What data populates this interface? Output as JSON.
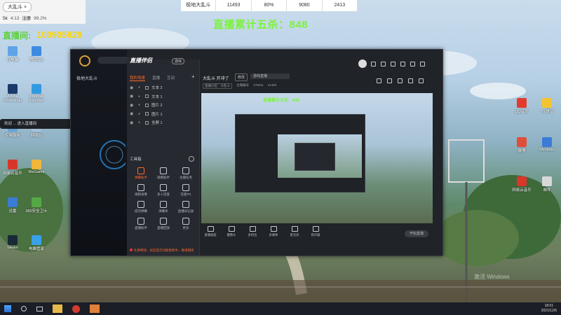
{
  "top_left": {
    "chip": "大乱斗 ×",
    "likes_label": "5k",
    "likes_value": "4:13",
    "rate_label": "注册",
    "rate_value": "99.2%"
  },
  "stats_row": [
    "极地大乱斗",
    "11493",
    "80%",
    "9080",
    "2413"
  ],
  "overlay": {
    "green_text": "直播累计五杀：848",
    "id_prefix": "直播间:",
    "id_number": "100905829"
  },
  "desktop_icons_left": [
    "此电脑",
    "腾讯QQ",
    "Adobe Photoshop",
    "Internet Explorer",
    "控制面板",
    "回收站",
    "网易云音乐",
    "WeGame",
    "迅雷",
    "360安全卫士",
    "Steam",
    "电脑管家"
  ],
  "desktop_icons_right": [
    "QQ音乐",
    "YY语音",
    "微博",
    "Windows",
    "网易云音乐",
    "邮件"
  ],
  "left_popup": "欢迎 ... 进入直播间",
  "app": {
    "title": "直播伴侣",
    "badge": "游戏",
    "game_tab": "极地大乱斗",
    "tabs": [
      "我的场景",
      "直播",
      "互动"
    ],
    "active_tab": 0,
    "scenes": [
      "文本 2",
      "文本 1",
      "图片 2",
      "图片 1",
      "全屏 1"
    ],
    "tools_title": "工具箱",
    "tools": [
      "弹幕助手",
      "观看助手",
      "主播任务",
      "视频录像",
      "多人连麦",
      "连麦PK",
      "成功弹幕",
      "弹幕条",
      "直播间记录",
      "直播助手",
      "直播回放",
      "更多"
    ],
    "stream_title": "大乱斗 开冲了",
    "edit_label": "修改",
    "category": "游戏直播",
    "meta": [
      "直播分区：大乱斗",
      "主播编号",
      "176611",
      "21483"
    ],
    "bottom_tools": [
      "直播画面",
      "摄像头",
      "多机位",
      "多媒体",
      "麦克风",
      "扬声器"
    ],
    "start_button": "开始直播",
    "notice": "礼物特效、状态显示功能更新中，敬请期待"
  },
  "nested_green": "直播累计五杀：848",
  "taskbar": {
    "time": "18:01",
    "date": "2021/12/6"
  },
  "watermark": "激活 Windows"
}
